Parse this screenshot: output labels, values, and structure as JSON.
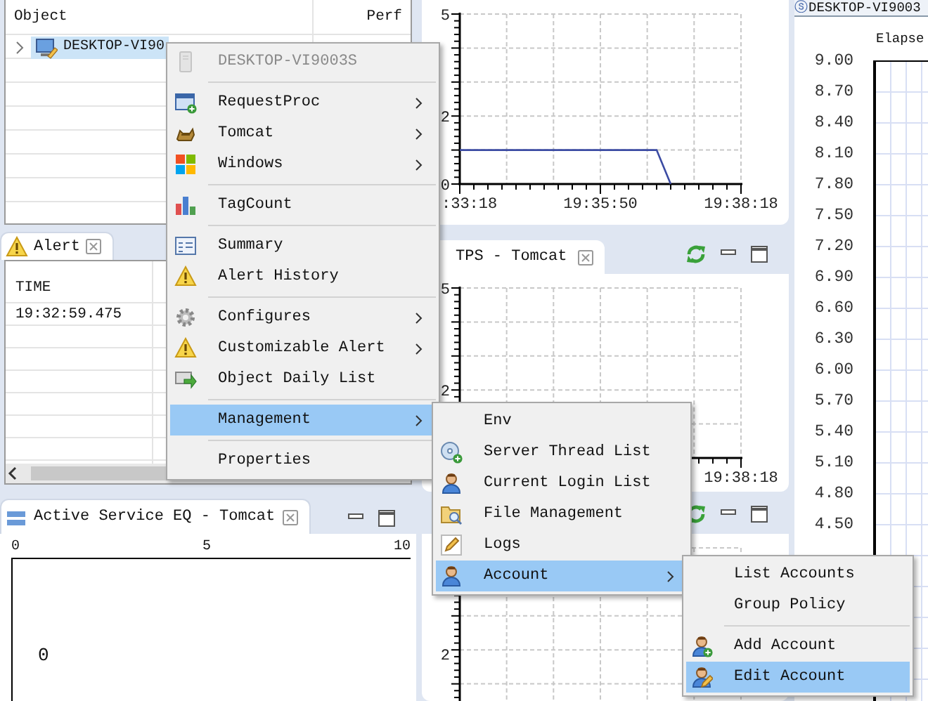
{
  "object_panel": {
    "columns": [
      "Object",
      "Perf"
    ],
    "rows": [
      {
        "name": "DESKTOP-VI90",
        "selected": true,
        "expanded": false
      }
    ]
  },
  "alert_panel": {
    "title": "Alert",
    "columns": [
      "TIME"
    ],
    "rows": [
      {
        "time": "19:32:59.475"
      }
    ]
  },
  "service_panel": {
    "title": "Active Service EQ - Tomcat",
    "scale": [
      "0",
      "5",
      "10"
    ],
    "value": "0"
  },
  "top_chart": {
    "chart_data": {
      "type": "line",
      "categories": [
        ":33:18",
        null,
        null,
        null,
        null,
        null,
        null,
        null,
        null,
        null,
        "19:35:50",
        null,
        null,
        null,
        null,
        null,
        null,
        null,
        null,
        null,
        "19:38:18"
      ],
      "series": [
        {
          "color": "#3b4ba3",
          "values": [
            1,
            1,
            1,
            1,
            1,
            1,
            1,
            1,
            1,
            1,
            1,
            1,
            1,
            1,
            1,
            0,
            null,
            null,
            null,
            null,
            null
          ]
        }
      ],
      "ylim": [
        0,
        5
      ],
      "yticks": [
        0,
        2,
        5
      ]
    }
  },
  "tps_panel": {
    "title": "TPS - Tomcat",
    "y_ticks": [
      "5",
      "2"
    ],
    "x_tick": "19:38:18"
  },
  "lower_panel": {
    "y_ticks": [
      "2"
    ]
  },
  "elapsed_panel": {
    "status_glyph": "ⓢ",
    "title": "DESKTOP-VI9003",
    "chart_title": "Elapse",
    "y_ticks": [
      "9.00",
      "8.70",
      "8.40",
      "8.10",
      "7.80",
      "7.50",
      "7.20",
      "6.90",
      "6.60",
      "6.30",
      "6.00",
      "5.70",
      "5.40",
      "5.10",
      "4.80",
      "4.50"
    ]
  },
  "menus": [
    {
      "groups": [
        {
          "items": [
            {
              "label": "DESKTOP-VI9003S",
              "submenu": false,
              "selected": false,
              "disabled": true
            }
          ]
        },
        {
          "items": [
            {
              "label": "RequestProc",
              "submenu": true,
              "selected": false,
              "disabled": false
            },
            {
              "label": "Tomcat",
              "submenu": true,
              "selected": false,
              "disabled": false
            },
            {
              "label": "Windows",
              "submenu": true,
              "selected": false,
              "disabled": false
            }
          ]
        },
        {
          "items": [
            {
              "label": "TagCount",
              "submenu": false,
              "selected": false,
              "disabled": false
            }
          ]
        },
        {
          "items": [
            {
              "label": "Summary",
              "submenu": false,
              "selected": false,
              "disabled": false
            },
            {
              "label": "Alert History",
              "submenu": false,
              "selected": false,
              "disabled": false
            }
          ]
        },
        {
          "items": [
            {
              "label": "Configures",
              "submenu": true,
              "selected": false,
              "disabled": false
            },
            {
              "label": "Customizable Alert",
              "submenu": true,
              "selected": false,
              "disabled": false
            },
            {
              "label": "Object Daily List",
              "submenu": false,
              "selected": false,
              "disabled": false
            }
          ]
        },
        {
          "items": [
            {
              "label": "Management",
              "submenu": true,
              "selected": true,
              "disabled": false
            }
          ]
        },
        {
          "items": [
            {
              "label": "Properties",
              "submenu": false,
              "selected": false,
              "disabled": false
            }
          ]
        }
      ]
    },
    {
      "groups": [
        {
          "items": [
            {
              "label": "Env",
              "submenu": false,
              "selected": false,
              "disabled": false
            },
            {
              "label": "Server Thread List",
              "submenu": false,
              "selected": false,
              "disabled": false
            },
            {
              "label": "Current Login List",
              "submenu": false,
              "selected": false,
              "disabled": false
            },
            {
              "label": "File Management",
              "submenu": false,
              "selected": false,
              "disabled": false
            },
            {
              "label": "Logs",
              "submenu": false,
              "selected": false,
              "disabled": false
            },
            {
              "label": "Account",
              "submenu": true,
              "selected": true,
              "disabled": false
            }
          ]
        }
      ]
    },
    {
      "groups": [
        {
          "items": [
            {
              "label": "List Accounts",
              "submenu": false,
              "selected": false,
              "disabled": false
            },
            {
              "label": "Group Policy",
              "submenu": false,
              "selected": false,
              "disabled": false
            }
          ]
        },
        {
          "items": [
            {
              "label": "Add Account",
              "submenu": false,
              "selected": false,
              "disabled": false
            },
            {
              "label": "Edit Account",
              "submenu": false,
              "selected": true,
              "disabled": false
            }
          ]
        }
      ]
    }
  ]
}
